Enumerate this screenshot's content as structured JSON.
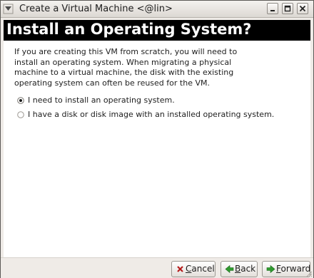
{
  "window": {
    "title": "Create a Virtual Machine <@lin>"
  },
  "page": {
    "heading": "Install an Operating System?",
    "description_lines": [
      "If you are creating this VM from scratch, you will need to",
      "install an operating system.  When migrating a physical",
      "machine to a virtual machine, the disk with the existing",
      "operating system can often be reused for the VM."
    ]
  },
  "options": [
    {
      "label": "I need to install an operating system.",
      "selected": true
    },
    {
      "label": "I have a disk or disk image with an installed operating system.",
      "selected": false
    }
  ],
  "buttons": {
    "cancel": {
      "mnemonic": "C",
      "rest": "ancel",
      "icon": "cancel-x-icon"
    },
    "back": {
      "mnemonic": "B",
      "rest": "ack",
      "icon": "back-arrow-icon"
    },
    "forward": {
      "mnemonic": "F",
      "rest": "orward",
      "icon": "forward-arrow-icon"
    }
  },
  "colors": {
    "header_background": "#000000",
    "header_text": "#ffffff",
    "arrow_green": "#2f9b2f",
    "cancel_red": "#b51b1b"
  }
}
